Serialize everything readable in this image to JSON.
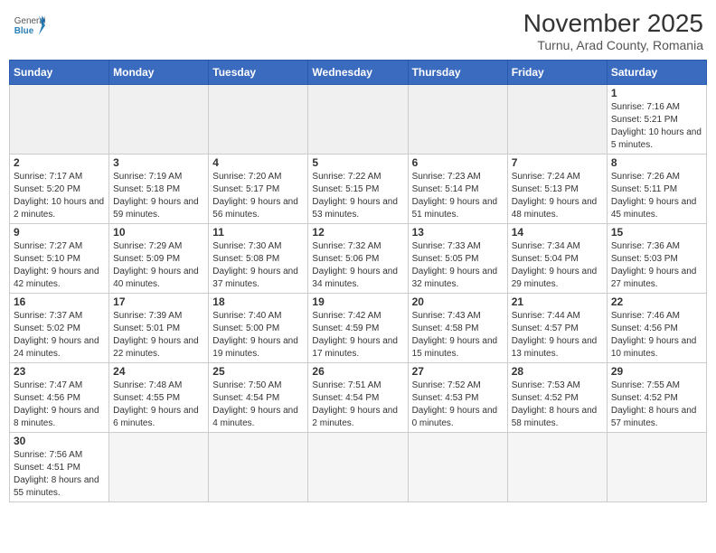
{
  "header": {
    "logo_general": "General",
    "logo_blue": "Blue",
    "month_title": "November 2025",
    "location": "Turnu, Arad County, Romania"
  },
  "weekdays": [
    "Sunday",
    "Monday",
    "Tuesday",
    "Wednesday",
    "Thursday",
    "Friday",
    "Saturday"
  ],
  "days": {
    "d1": {
      "num": "1",
      "sunrise": "7:16 AM",
      "sunset": "5:21 PM",
      "daylight": "10 hours and 5 minutes."
    },
    "d2": {
      "num": "2",
      "sunrise": "7:17 AM",
      "sunset": "5:20 PM",
      "daylight": "10 hours and 2 minutes."
    },
    "d3": {
      "num": "3",
      "sunrise": "7:19 AM",
      "sunset": "5:18 PM",
      "daylight": "9 hours and 59 minutes."
    },
    "d4": {
      "num": "4",
      "sunrise": "7:20 AM",
      "sunset": "5:17 PM",
      "daylight": "9 hours and 56 minutes."
    },
    "d5": {
      "num": "5",
      "sunrise": "7:22 AM",
      "sunset": "5:15 PM",
      "daylight": "9 hours and 53 minutes."
    },
    "d6": {
      "num": "6",
      "sunrise": "7:23 AM",
      "sunset": "5:14 PM",
      "daylight": "9 hours and 51 minutes."
    },
    "d7": {
      "num": "7",
      "sunrise": "7:24 AM",
      "sunset": "5:13 PM",
      "daylight": "9 hours and 48 minutes."
    },
    "d8": {
      "num": "8",
      "sunrise": "7:26 AM",
      "sunset": "5:11 PM",
      "daylight": "9 hours and 45 minutes."
    },
    "d9": {
      "num": "9",
      "sunrise": "7:27 AM",
      "sunset": "5:10 PM",
      "daylight": "9 hours and 42 minutes."
    },
    "d10": {
      "num": "10",
      "sunrise": "7:29 AM",
      "sunset": "5:09 PM",
      "daylight": "9 hours and 40 minutes."
    },
    "d11": {
      "num": "11",
      "sunrise": "7:30 AM",
      "sunset": "5:08 PM",
      "daylight": "9 hours and 37 minutes."
    },
    "d12": {
      "num": "12",
      "sunrise": "7:32 AM",
      "sunset": "5:06 PM",
      "daylight": "9 hours and 34 minutes."
    },
    "d13": {
      "num": "13",
      "sunrise": "7:33 AM",
      "sunset": "5:05 PM",
      "daylight": "9 hours and 32 minutes."
    },
    "d14": {
      "num": "14",
      "sunrise": "7:34 AM",
      "sunset": "5:04 PM",
      "daylight": "9 hours and 29 minutes."
    },
    "d15": {
      "num": "15",
      "sunrise": "7:36 AM",
      "sunset": "5:03 PM",
      "daylight": "9 hours and 27 minutes."
    },
    "d16": {
      "num": "16",
      "sunrise": "7:37 AM",
      "sunset": "5:02 PM",
      "daylight": "9 hours and 24 minutes."
    },
    "d17": {
      "num": "17",
      "sunrise": "7:39 AM",
      "sunset": "5:01 PM",
      "daylight": "9 hours and 22 minutes."
    },
    "d18": {
      "num": "18",
      "sunrise": "7:40 AM",
      "sunset": "5:00 PM",
      "daylight": "9 hours and 19 minutes."
    },
    "d19": {
      "num": "19",
      "sunrise": "7:42 AM",
      "sunset": "4:59 PM",
      "daylight": "9 hours and 17 minutes."
    },
    "d20": {
      "num": "20",
      "sunrise": "7:43 AM",
      "sunset": "4:58 PM",
      "daylight": "9 hours and 15 minutes."
    },
    "d21": {
      "num": "21",
      "sunrise": "7:44 AM",
      "sunset": "4:57 PM",
      "daylight": "9 hours and 13 minutes."
    },
    "d22": {
      "num": "22",
      "sunrise": "7:46 AM",
      "sunset": "4:56 PM",
      "daylight": "9 hours and 10 minutes."
    },
    "d23": {
      "num": "23",
      "sunrise": "7:47 AM",
      "sunset": "4:56 PM",
      "daylight": "9 hours and 8 minutes."
    },
    "d24": {
      "num": "24",
      "sunrise": "7:48 AM",
      "sunset": "4:55 PM",
      "daylight": "9 hours and 6 minutes."
    },
    "d25": {
      "num": "25",
      "sunrise": "7:50 AM",
      "sunset": "4:54 PM",
      "daylight": "9 hours and 4 minutes."
    },
    "d26": {
      "num": "26",
      "sunrise": "7:51 AM",
      "sunset": "4:54 PM",
      "daylight": "9 hours and 2 minutes."
    },
    "d27": {
      "num": "27",
      "sunrise": "7:52 AM",
      "sunset": "4:53 PM",
      "daylight": "9 hours and 0 minutes."
    },
    "d28": {
      "num": "28",
      "sunrise": "7:53 AM",
      "sunset": "4:52 PM",
      "daylight": "8 hours and 58 minutes."
    },
    "d29": {
      "num": "29",
      "sunrise": "7:55 AM",
      "sunset": "4:52 PM",
      "daylight": "8 hours and 57 minutes."
    },
    "d30": {
      "num": "30",
      "sunrise": "7:56 AM",
      "sunset": "4:51 PM",
      "daylight": "8 hours and 55 minutes."
    }
  }
}
